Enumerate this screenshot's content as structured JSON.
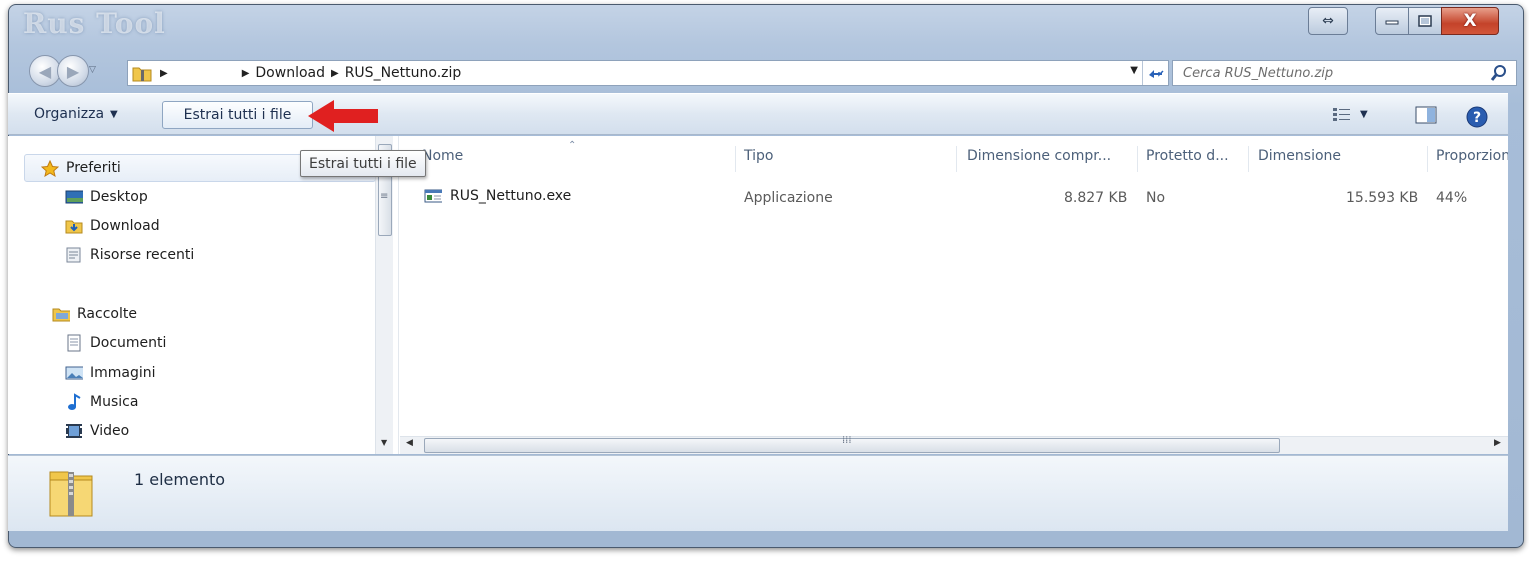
{
  "window": {
    "title": "Rus Tool",
    "buttons": {
      "restore_glyph": "⇔",
      "minimize_glyph": "▭",
      "maximize_glyph": "☐",
      "close_glyph": "X"
    }
  },
  "navbar": {
    "breadcrumbs": [
      "Download",
      "RUS_Nettuno.zip"
    ]
  },
  "search": {
    "placeholder": "Cerca RUS_Nettuno.zip"
  },
  "command_bar": {
    "organize_label": "Organizza",
    "extract_label": "Estrai tutti i file"
  },
  "tooltip": {
    "text": "Estrai tutti i file"
  },
  "nav_pane": {
    "favorites": {
      "label": "Preferiti",
      "items": [
        "Desktop",
        "Download",
        "Risorse recenti"
      ]
    },
    "libraries": {
      "label": "Raccolte",
      "items": [
        "Documenti",
        "Immagini",
        "Musica",
        "Video"
      ]
    }
  },
  "columns": [
    "Nome",
    "Tipo",
    "Dimensione compr...",
    "Protetto d...",
    "Dimensione",
    "Proporzioni"
  ],
  "files": [
    {
      "name": "RUS_Nettuno.exe",
      "type": "Applicazione",
      "compressed": "8.827 KB",
      "protected": "No",
      "size": "15.593 KB",
      "ratio": "44%"
    }
  ],
  "details": {
    "count_text": "1 elemento"
  },
  "colors": {
    "accent_red": "#e02020",
    "window_frame": "#a7bdd8",
    "selection": "#e7eef7"
  }
}
